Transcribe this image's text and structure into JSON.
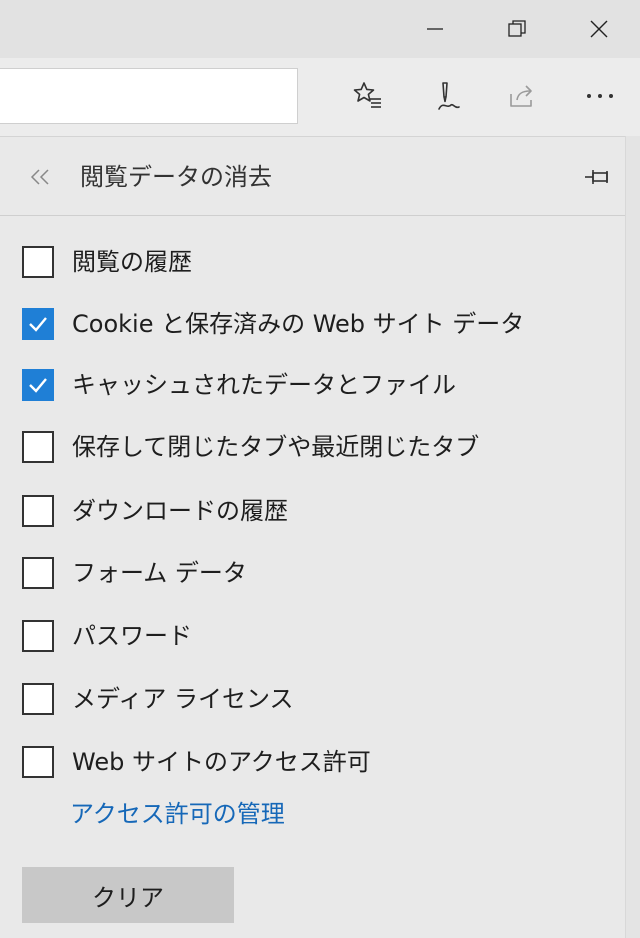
{
  "panel": {
    "title": "閲覧データの消去",
    "options": [
      {
        "label": "閲覧の履歴",
        "checked": false
      },
      {
        "label": "Cookie と保存済みの Web サイト データ",
        "checked": true
      },
      {
        "label": "キャッシュされたデータとファイル",
        "checked": true
      },
      {
        "label": "保存して閉じたタブや最近閉じたタブ",
        "checked": false
      },
      {
        "label": "ダウンロードの履歴",
        "checked": false
      },
      {
        "label": "フォーム データ",
        "checked": false
      },
      {
        "label": "パスワード",
        "checked": false
      },
      {
        "label": "メディア ライセンス",
        "checked": false
      },
      {
        "label": "Web サイトのアクセス許可",
        "checked": false
      }
    ],
    "manage_link": "アクセス許可の管理",
    "clear_label": "クリア"
  },
  "toolbar": {
    "icons": [
      "favorites-star-icon",
      "pen-notes-icon",
      "share-icon",
      "more-dots-icon"
    ]
  },
  "colors": {
    "checkbox_checked": "#1f7fd6",
    "link": "#1668b8",
    "clear_button": "#c8c8c8"
  }
}
